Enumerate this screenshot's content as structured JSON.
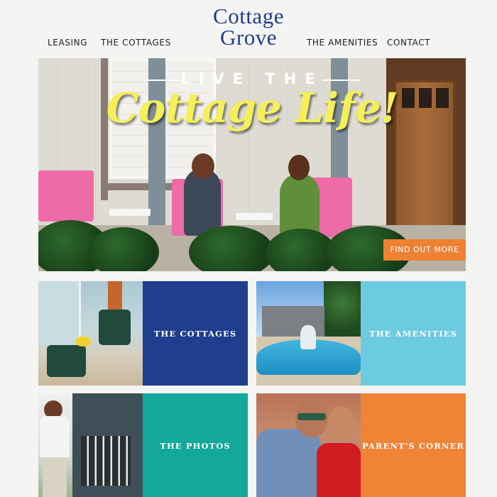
{
  "brand": {
    "logo_line1": "Cottage",
    "logo_line2": "Grove",
    "color": "#1f3e8e"
  },
  "nav": {
    "items": [
      {
        "label": "LEASING"
      },
      {
        "label": "THE COTTAGES"
      },
      {
        "label": "THE AMENITIES"
      },
      {
        "label": "CONTACT"
      }
    ]
  },
  "hero": {
    "kicker": "LIVE THE",
    "tagline": "Cottage Life!",
    "cta_label": "FIND OUT MORE",
    "cta_color": "#ee8133"
  },
  "tiles": [
    {
      "label": "THE COTTAGES",
      "color": "#1f3e8e"
    },
    {
      "label": "THE AMENITIES",
      "color": "#6ccbe0"
    },
    {
      "label": "THE PHOTOS",
      "color": "#14a89a"
    },
    {
      "label": "PARENT'S CORNER",
      "color": "#ef8336"
    }
  ]
}
